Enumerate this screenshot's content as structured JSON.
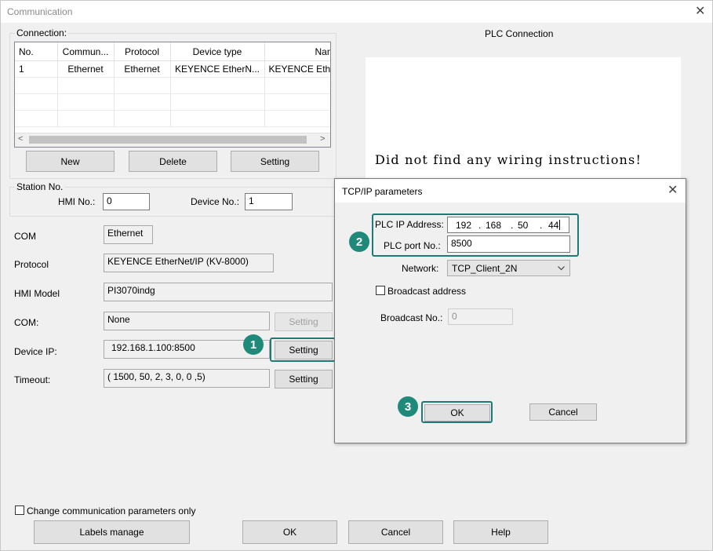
{
  "window": {
    "title": "Communication",
    "close_glyph": "✕"
  },
  "connection": {
    "group_label": "Connection:",
    "columns": [
      "No.",
      "Commun...",
      "Protocol",
      "Device type",
      "Name"
    ],
    "rows": [
      [
        "1",
        "Ethernet",
        "Ethernet",
        "KEYENCE EtherN...",
        "KEYENCE Ethe"
      ]
    ],
    "scroll_left": "<",
    "scroll_right": ">",
    "buttons": {
      "new": "New",
      "delete": "Delete",
      "setting": "Setting"
    }
  },
  "station": {
    "group_label": "Station No.",
    "hmi_label": "HMI No.:",
    "hmi_value": "0",
    "device_label": "Device No.:",
    "device_value": "1"
  },
  "props": {
    "com_label": "COM",
    "com_value": "Ethernet",
    "protocol_label": "Protocol",
    "protocol_value": "KEYENCE EtherNet/IP (KV-8000)",
    "hmi_model_label": "HMI Model",
    "hmi_model_value": "PI3070indg",
    "com2_label": "COM:",
    "com2_value": "None",
    "com2_button": "Setting",
    "device_ip_label": "Device IP:",
    "device_ip_value": "192.168.1.100:8500",
    "device_ip_button": "Setting",
    "timeout_label": "Timeout:",
    "timeout_value": "( 1500, 50, 2, 3, 0, 0 ,5)",
    "timeout_button": "Setting"
  },
  "plc_connection": {
    "title": "PLC Connection",
    "message": "Did not find any wiring instructions!"
  },
  "footer": {
    "change_only_label": "Change communication parameters only",
    "labels_manage": "Labels manage",
    "ok": "OK",
    "cancel": "Cancel",
    "help": "Help"
  },
  "tcpip_dialog": {
    "title": "TCP/IP parameters",
    "close_glyph": "✕",
    "plc_ip_label": "PLC IP Address:",
    "ip_octets": [
      "192",
      "168",
      "50",
      "44"
    ],
    "port_label": "PLC port No.:",
    "port_value": "8500",
    "network_label": "Network:",
    "network_value": "TCP_Client_2N",
    "broadcast_addr_label": "Broadcast address",
    "broadcast_no_label": "Broadcast No.:",
    "broadcast_no_value": "0",
    "ok": "OK",
    "cancel": "Cancel"
  },
  "callouts": [
    "1",
    "2",
    "3"
  ],
  "colors": {
    "callout": "#1f8a7a",
    "highlight": "#1f7a74"
  }
}
